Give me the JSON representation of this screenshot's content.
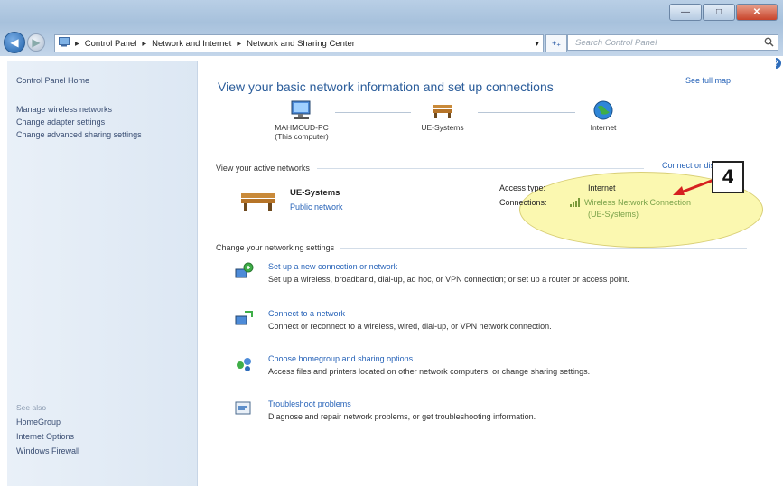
{
  "window": {
    "minimize_symbol": "—",
    "maximize_symbol": "□",
    "close_symbol": "✕"
  },
  "nav": {
    "back_symbol": "◀",
    "forward_symbol": "▶",
    "address": [
      "Control Panel",
      "Network and Internet",
      "Network and Sharing Center"
    ],
    "separator": "▸",
    "dropdown_symbol": "▾",
    "refresh_symbol": "+₊",
    "search_placeholder": "Search Control Panel",
    "search_icon": "magnifier-icon",
    "help_symbol": "?"
  },
  "sidebar": {
    "home": "Control Panel Home",
    "items": [
      "Manage wireless networks",
      "Change adapter settings",
      "Change advanced sharing settings"
    ],
    "see_also_label": "See also",
    "see_also": [
      "HomeGroup",
      "Internet Options",
      "Windows Firewall"
    ]
  },
  "main": {
    "heading": "View your basic network information and set up connections",
    "see_full_map": "See full map",
    "map_nodes": [
      {
        "name": "MAHMOUD-PC",
        "sub": "(This computer)",
        "icon": "computer-icon"
      },
      {
        "name": "UE-Systems",
        "sub": "",
        "icon": "bench-icon"
      },
      {
        "name": "Internet",
        "sub": "",
        "icon": "globe-icon"
      }
    ],
    "active_networks_header": "View your active networks",
    "connect_or_disconnect": "Connect or disc",
    "network": {
      "name": "UE-Systems",
      "type": "Public network",
      "access_type_label": "Access type:",
      "access_type_value": "Internet",
      "connections_label": "Connections:",
      "connection_value_line1": "Wireless Network Connection",
      "connection_value_line2": "(UE-Systems)"
    },
    "change_settings_header": "Change your networking settings",
    "tasks": [
      {
        "title": "Set up a new connection or network",
        "desc": "Set up a wireless, broadband, dial-up, ad hoc, or VPN connection; or set up a router or access point.",
        "icon": "new-connection-icon"
      },
      {
        "title": "Connect to a network",
        "desc": "Connect or reconnect to a wireless, wired, dial-up, or VPN network connection.",
        "icon": "connect-network-icon"
      },
      {
        "title": "Choose homegroup and sharing options",
        "desc": "Access files and printers located on other network computers, or change sharing settings.",
        "icon": "homegroup-icon"
      },
      {
        "title": "Troubleshoot problems",
        "desc": "Diagnose and repair network problems, or get troubleshooting information.",
        "icon": "troubleshoot-icon"
      }
    ]
  },
  "annotation": {
    "callout_number": "4",
    "highlight_color": "#f6f08c",
    "arrow_color": "#d62020"
  }
}
